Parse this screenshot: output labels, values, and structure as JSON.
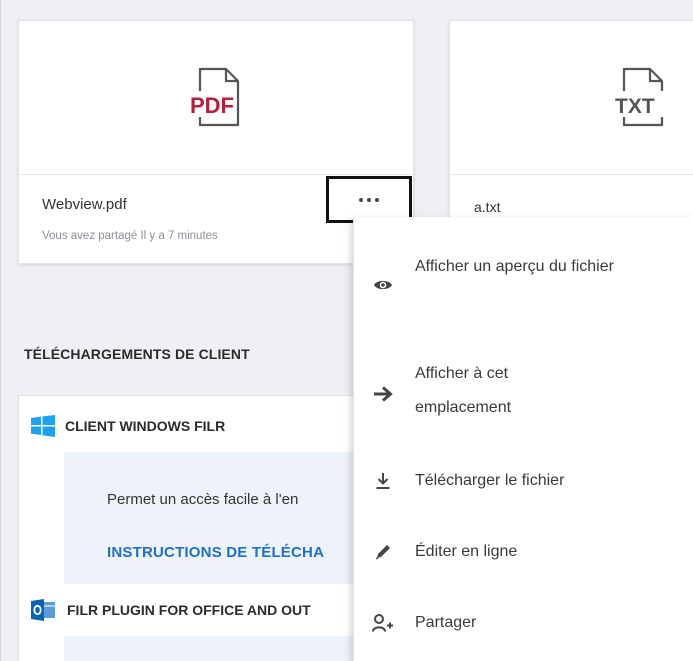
{
  "files": [
    {
      "name": "Webview.pdf",
      "meta": "Vous avez partagé Il y a 7 minutes",
      "type_label": "PDF",
      "type_color": "#b5213a",
      "icon": "pdf-file-icon"
    },
    {
      "name": "a.txt",
      "type_label": "TXT",
      "type_color": "#555555",
      "icon": "txt-file-icon"
    }
  ],
  "more_button_icon": "more-options-icon",
  "section": {
    "title": "TÉLÉCHARGEMENTS DE CLIENT"
  },
  "clients": [
    {
      "label": "CLIENT WINDOWS FILR",
      "icon": "windows-logo-icon",
      "description": "Permet un accès facile à l'en",
      "link": "INSTRUCTIONS DE TÉLÉCHA"
    },
    {
      "label": "FILR PLUGIN FOR OFFICE AND OUT",
      "icon": "outlook-logo-icon"
    }
  ],
  "context_menu": {
    "items": [
      {
        "label": "Afficher un aperçu du fichier",
        "icon": "eye-icon"
      },
      {
        "label": "Afficher à cet emplacement",
        "icon": "arrow-right-icon"
      },
      {
        "label": "Télécharger le fichier",
        "icon": "download-icon"
      },
      {
        "label": "Éditer en ligne",
        "icon": "pencil-icon"
      },
      {
        "label": "Partager",
        "icon": "share-user-icon"
      }
    ]
  },
  "colors": {
    "link": "#1f6fc5",
    "windows_blue": "#1da1f2",
    "outlook_blue": "#0a64b4",
    "pdf_red": "#b5213a"
  }
}
